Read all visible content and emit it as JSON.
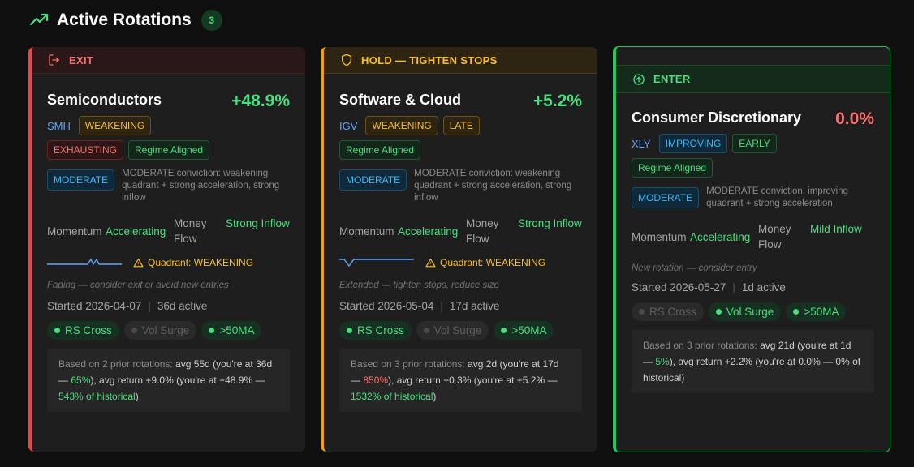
{
  "header": {
    "title": "Active Rotations",
    "count": "3",
    "icon": "trending-up-icon"
  },
  "cards": [
    {
      "action": "EXIT",
      "action_icon": "log-out-icon",
      "sector": "Semiconductors",
      "change": "+48.9%",
      "ticker": "SMH",
      "tags": [
        "WEAKENING",
        "EXHAUSTING",
        "Regime Aligned"
      ],
      "conviction": "MODERATE",
      "conviction_text": "MODERATE conviction: weakening quadrant + strong acceleration, strong inflow",
      "momentum_label": "Momentum",
      "momentum_value": "Accelerating",
      "flow_label": "Money Flow",
      "flow_value": "Strong Inflow",
      "quadrant_warning": "Quadrant: WEAKENING",
      "hint": "Fading — consider exit or avoid new entries",
      "started": "Started 2026-04-07",
      "active": "36d active",
      "signals": [
        {
          "label": "RS Cross",
          "on": true
        },
        {
          "label": "Vol Surge",
          "on": false
        },
        {
          "label": ">50MA",
          "on": true
        }
      ],
      "history": {
        "p1": "Based on 2 prior rotations: ",
        "p2": "avg 55d (you're at 36d — ",
        "p3": "65%",
        "p4": "), avg return +9.0% (you're at +48.9% — ",
        "p5": "543% of historical",
        "p6": ")"
      }
    },
    {
      "action": "HOLD — TIGHTEN STOPS",
      "action_icon": "shield-icon",
      "sector": "Software & Cloud",
      "change": "+5.2%",
      "ticker": "IGV",
      "tags": [
        "WEAKENING",
        "LATE",
        "Regime Aligned"
      ],
      "conviction": "MODERATE",
      "conviction_text": "MODERATE conviction: weakening quadrant + strong acceleration, strong inflow",
      "momentum_label": "Momentum",
      "momentum_value": "Accelerating",
      "flow_label": "Money Flow",
      "flow_value": "Strong Inflow",
      "quadrant_warning": "Quadrant: WEAKENING",
      "hint": "Extended — tighten stops, reduce size",
      "started": "Started 2026-05-04",
      "active": "17d active",
      "signals": [
        {
          "label": "RS Cross",
          "on": true
        },
        {
          "label": "Vol Surge",
          "on": false
        },
        {
          "label": ">50MA",
          "on": true
        }
      ],
      "history": {
        "p1": "Based on 3 prior rotations: ",
        "p2": "avg 2d (you're at 17d — ",
        "p3": "850%",
        "p4": "), avg return +0.3% (you're at +5.2% — ",
        "p5": "1532% of historical",
        "p6": ")"
      }
    },
    {
      "action": "ENTER",
      "action_icon": "arrow-up-circle-icon",
      "sector": "Consumer Discretionary",
      "change": "0.0%",
      "ticker": "XLY",
      "tags": [
        "IMPROVING",
        "EARLY",
        "Regime Aligned"
      ],
      "conviction": "MODERATE",
      "conviction_text": "MODERATE conviction: improving quadrant + strong acceleration",
      "momentum_label": "Momentum",
      "momentum_value": "Accelerating",
      "flow_label": "Money Flow",
      "flow_value": "Mild Inflow",
      "hint": "New rotation — consider entry",
      "started": "Started 2026-05-27",
      "active": "1d active",
      "signals": [
        {
          "label": "RS Cross",
          "on": false
        },
        {
          "label": "Vol Surge",
          "on": true
        },
        {
          "label": ">50MA",
          "on": true
        }
      ],
      "history": {
        "p1": "Based on 3 prior rotations: ",
        "p2": "avg 21d (you're at 1d — ",
        "p3": "5%",
        "p4": "), avg return +2.2% (you're at 0.0% — 0% of historical)"
      }
    }
  ]
}
